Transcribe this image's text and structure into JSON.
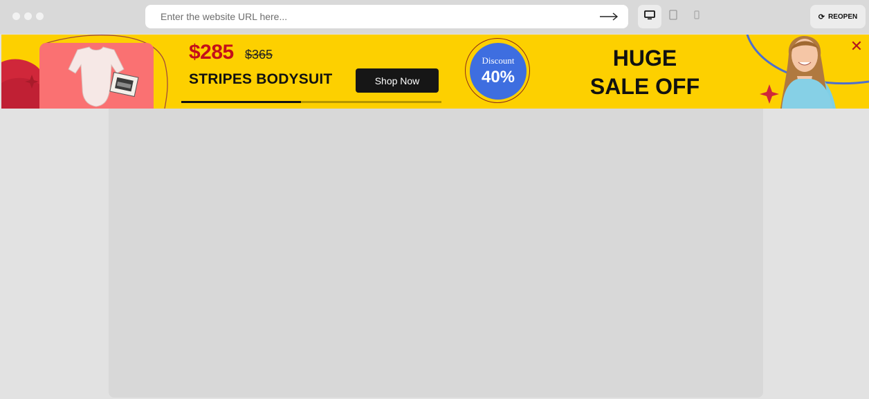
{
  "browser": {
    "url_placeholder": "Enter the website URL here...",
    "go_icon": "arrow-right-icon",
    "devices": [
      {
        "name": "desktop",
        "icon": "desktop-icon",
        "active": true
      },
      {
        "name": "tablet",
        "icon": "tablet-icon",
        "active": false
      },
      {
        "name": "mobile",
        "icon": "mobile-icon",
        "active": false
      }
    ],
    "reopen_label": "REOPEN",
    "reopen_icon": "refresh-icon"
  },
  "banner": {
    "price_now": "$285",
    "price_old": "$365",
    "product_name": "STRIPES BODYSUIT",
    "shop_button": "Shop Now",
    "discount_label": "Discount",
    "discount_value": "40%",
    "sale_line1": "HUGE",
    "sale_line2": "SALE OFF",
    "progress_fraction": 0.46,
    "close_icon": "close-icon",
    "colors": {
      "background": "#fdd000",
      "price": "#c40f1a",
      "discount": "#3e6ee0",
      "card": "#fa7172"
    }
  }
}
